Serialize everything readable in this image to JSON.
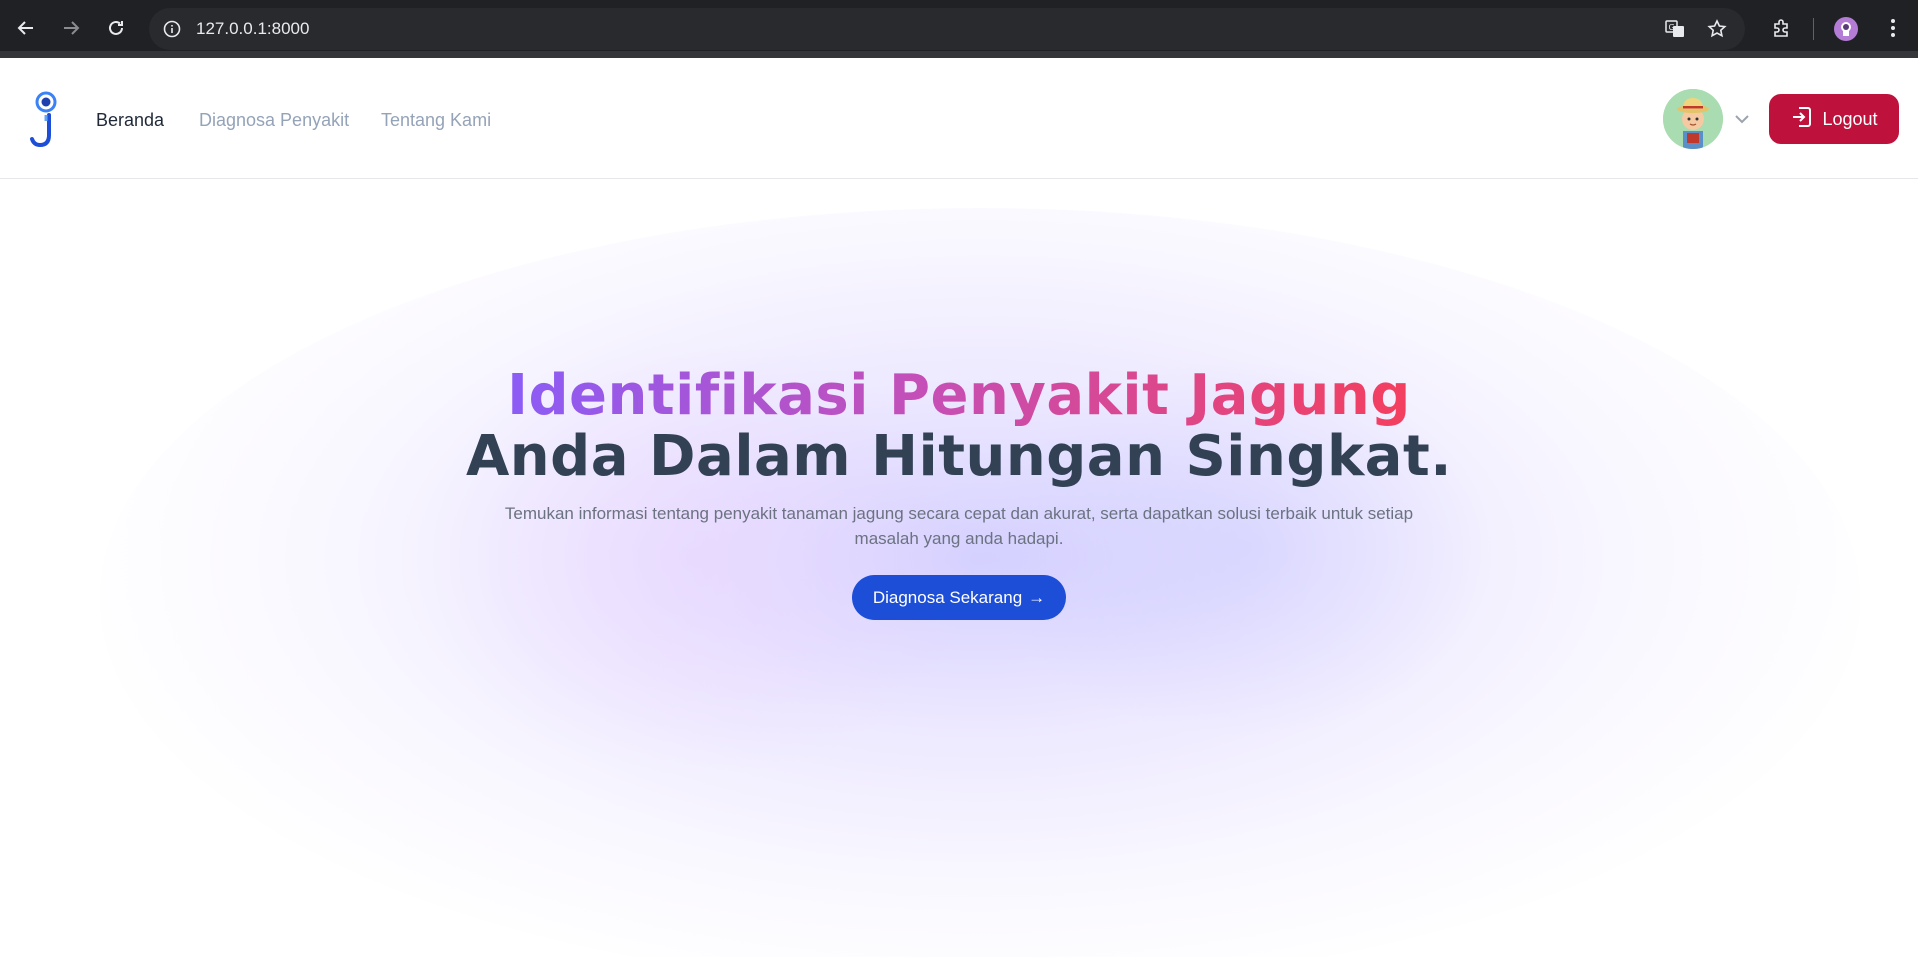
{
  "browser": {
    "url": "127.0.0.1:8000",
    "icons": [
      "back-icon",
      "forward-icon",
      "reload-icon",
      "info-icon",
      "translate-icon",
      "bookmark-star-icon",
      "extensions-icon",
      "profile-icon",
      "menu-dots-icon"
    ]
  },
  "header": {
    "nav": [
      "Beranda",
      "Diagnosa Penyakit",
      "Tentang Kami"
    ],
    "active_nav": "Beranda",
    "logout_label": "Logout"
  },
  "hero": {
    "title_line1": "Identifikasi Penyakit Jagung",
    "title_line2": "Anda Dalam Hitungan Singkat.",
    "subtitle": "Temukan informasi tentang penyakit tanaman jagung secara cepat dan akurat, serta dapatkan solusi terbaik untuk setiap masalah yang anda hadapi.",
    "cta_label": "Diagnosa Sekarang",
    "cta_arrow": "→"
  },
  "colors": {
    "logout_bg": "#be123c",
    "cta_bg": "#1d4ed8",
    "title_dark": "#334155",
    "gradient_start": "#8b5cf6",
    "gradient_end": "#f43f5e"
  }
}
